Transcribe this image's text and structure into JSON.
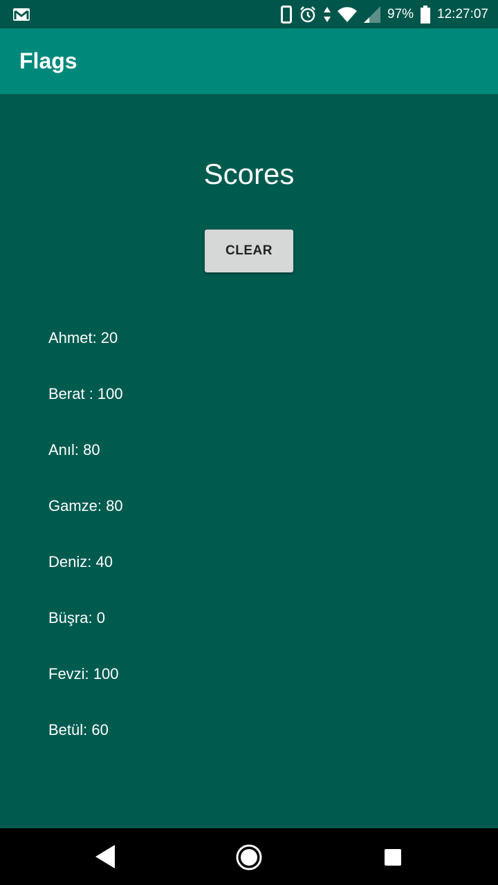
{
  "status_bar": {
    "battery_percent": "97%",
    "time": "12:27:07",
    "icons": [
      "gmail-icon",
      "phone-icon",
      "alarm-icon",
      "data-arrows-icon",
      "wifi-icon",
      "signal-icon",
      "battery-icon"
    ]
  },
  "app_bar": {
    "title": "Flags"
  },
  "main": {
    "title": "Scores",
    "clear_label": "CLEAR",
    "scores": [
      "Ahmet: 20",
      "Berat : 100",
      "Anıl: 80",
      "Gamze: 80",
      "Deniz: 40",
      "Büşra: 0",
      "Fevzi: 100",
      "Betül: 60"
    ]
  },
  "nav_bar": {
    "icons": [
      "back-icon",
      "home-icon",
      "recents-icon"
    ]
  },
  "colors": {
    "status_bar": "#00564a",
    "app_bar": "#00897b",
    "background": "#005b4f",
    "button": "#d6d7d7"
  }
}
